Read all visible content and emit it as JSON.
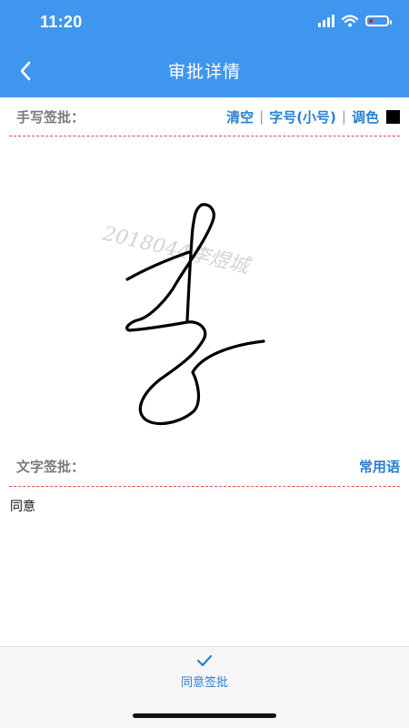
{
  "status_bar": {
    "time": "11:20",
    "icons": [
      "signal-icon",
      "wifi-icon",
      "battery-icon"
    ],
    "battery_level": 0.2,
    "battery_color": "#e02020"
  },
  "nav": {
    "title": "审批详情",
    "back_icon": "chevron-left-icon"
  },
  "handwriting": {
    "label": "手写签批：",
    "actions": {
      "clear": "清空",
      "font_size": "字号(小号)",
      "color": "调色",
      "separator": "|"
    },
    "swatch_color": "#000000",
    "watermark": "2018044李煜城"
  },
  "text_sign": {
    "label": "文字签批：",
    "common_phrases": "常用语",
    "content": "同意"
  },
  "bottom": {
    "approve_label": "同意签批",
    "approve_icon": "check-icon"
  },
  "colors": {
    "header": "#3f96ee",
    "link": "#2a7fd4",
    "divider": "#e04848"
  }
}
